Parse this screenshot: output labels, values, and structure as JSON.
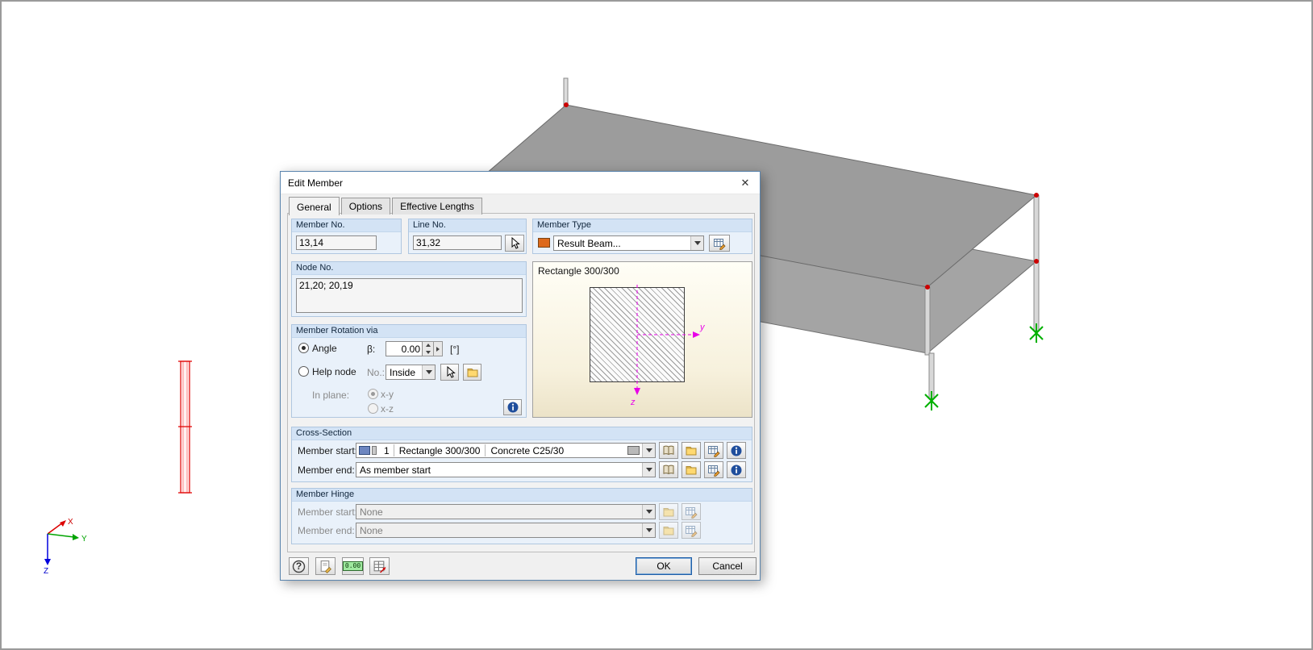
{
  "window": {
    "title": "Edit Member",
    "close_glyph": "✕"
  },
  "tabs": [
    {
      "label": "General",
      "active": true
    },
    {
      "label": "Options",
      "active": false
    },
    {
      "label": "Effective Lengths",
      "active": false
    }
  ],
  "member_no": {
    "title": "Member No.",
    "value": "13,14"
  },
  "line_no": {
    "title": "Line No.",
    "value": "31,32"
  },
  "member_type": {
    "title": "Member Type",
    "value": "Result Beam..."
  },
  "node_no": {
    "title": "Node No.",
    "value": "21,20; 20,19"
  },
  "rotation": {
    "title": "Member Rotation via",
    "angle_label": "Angle",
    "beta_symbol": "β:",
    "angle_value": "0.00",
    "angle_unit": "[°]",
    "help_node_label": "Help node",
    "no_label": "No.:",
    "help_node_value": "Inside",
    "in_plane_label": "In plane:",
    "plane_options": [
      "x-y",
      "x-z"
    ]
  },
  "preview": {
    "title": "Rectangle 300/300",
    "axis_y_label": "y",
    "axis_z_label": "z"
  },
  "cross_section": {
    "title": "Cross-Section",
    "member_start_label": "Member start:",
    "start_no": "1",
    "start_section": "Rectangle 300/300",
    "start_material": "Concrete C25/30",
    "member_end_label": "Member end:",
    "end_value": "As member start"
  },
  "member_hinge": {
    "title": "Member Hinge",
    "member_start_label": "Member start:",
    "start_value": "None",
    "member_end_label": "Member end:",
    "end_value": "None"
  },
  "footer": {
    "help_glyph": "?",
    "calc_display": "0.00",
    "ok_label": "OK",
    "cancel_label": "Cancel"
  },
  "viewport": {
    "axis_x": "X",
    "axis_y": "Y",
    "axis_z": "Z"
  },
  "colors": {
    "member_type_swatch": "#DD6A1C",
    "section_swatch_blue": "#6D86C0",
    "section_axis_magenta": "#E800E8",
    "selected_member_red": "#E00000",
    "support_green": "#00B000",
    "slab_gray": "#9C9C9C"
  }
}
